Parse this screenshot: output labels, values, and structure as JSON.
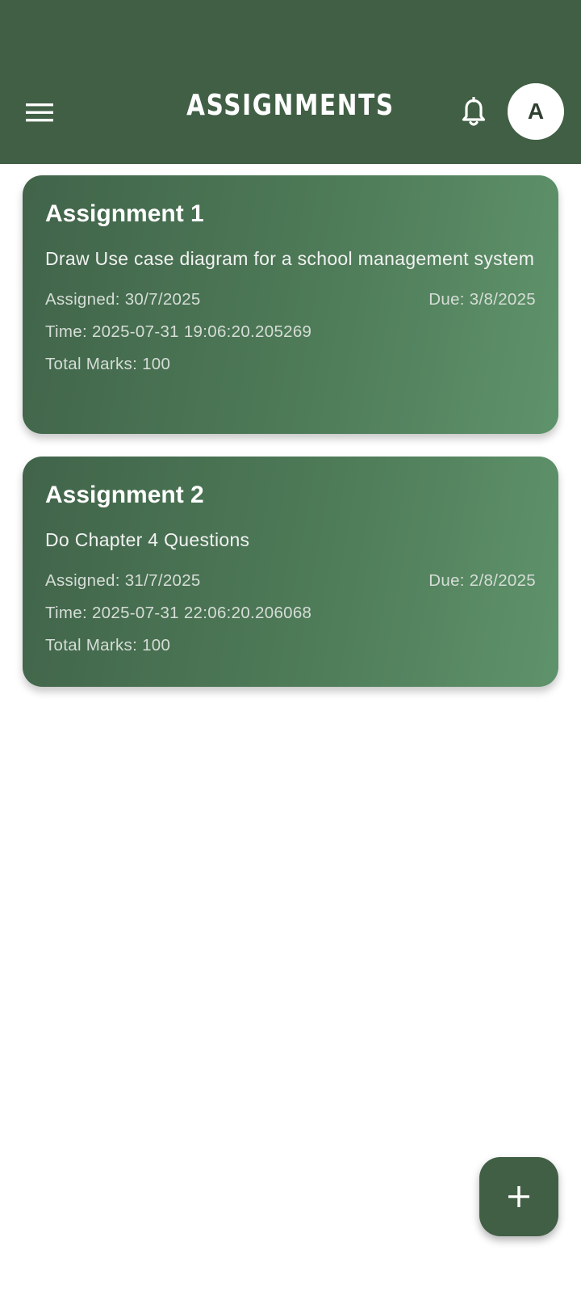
{
  "app_bar": {
    "title": "ASSIGNMENTS",
    "menu_icon": "menu-icon",
    "notification_icon": "bell-icon",
    "avatar_letter": "A",
    "background_color": "#415f45"
  },
  "assignments": [
    {
      "title": "Assignment 1",
      "description": "Draw Use case diagram for a school management system",
      "assigned": "Assigned: 30/7/2025",
      "due": "Due: 3/8/2025",
      "time": "Time: 2025-07-31 19:06:20.205269",
      "total_marks": "Total Marks: 100"
    },
    {
      "title": "Assignment 2",
      "description": "Do Chapter 4 Questions",
      "assigned": "Assigned: 31/7/2025",
      "due": "Due: 2/8/2025",
      "time": "Time: 2025-07-31 22:06:20.206068",
      "total_marks": "Total Marks: 100"
    }
  ],
  "fab": {
    "icon": "plus-icon"
  }
}
